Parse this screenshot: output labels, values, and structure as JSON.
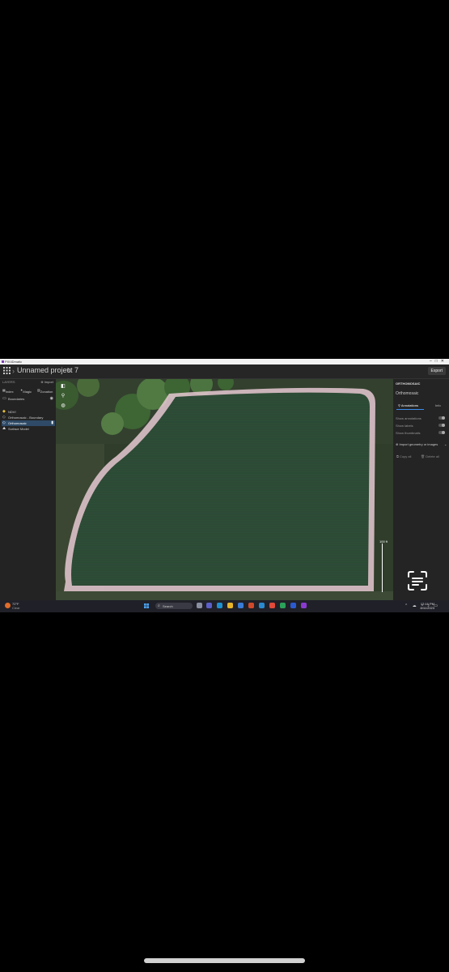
{
  "window": {
    "title": "PIX4Dmatic"
  },
  "header": {
    "project_title": "Unnamed project 7",
    "export_label": "Export"
  },
  "left_panel": {
    "header": "LAYERS",
    "import_label": "Import",
    "tools": [
      "Index",
      "Magic",
      "Zonation"
    ],
    "boundaries_label": "Boundaries",
    "layers": [
      {
        "label": "NDVI",
        "icon": "ndvi-icon"
      },
      {
        "label": "Orthomosaic - Boundary",
        "icon": "boundary-icon"
      },
      {
        "label": "Orthomosaic",
        "icon": "orthomosaic-icon",
        "selected": true
      },
      {
        "label": "Surface Model",
        "icon": "surface-model-icon"
      }
    ]
  },
  "map": {
    "scale_label": "100 ft"
  },
  "right_panel": {
    "title": "ORTHOMOSAIC",
    "subtitle": "Orthomosaic",
    "tabs": [
      "Annotations",
      "Info"
    ],
    "options": [
      "Show annotations",
      "Show labels",
      "Show thumbnails"
    ],
    "import_label": "Import geometry or images",
    "copy_label": "Copy all",
    "delete_label": "Delete all"
  },
  "taskbar": {
    "weather_temp": "72°F",
    "weather_desc": "Clear",
    "search_placeholder": "Search",
    "time": "12:16 PM",
    "date": "8/11/2023"
  },
  "colors": {
    "accent": "#3d8ef0",
    "selected_row": "#2e4a66",
    "field": "#2b4a33"
  }
}
